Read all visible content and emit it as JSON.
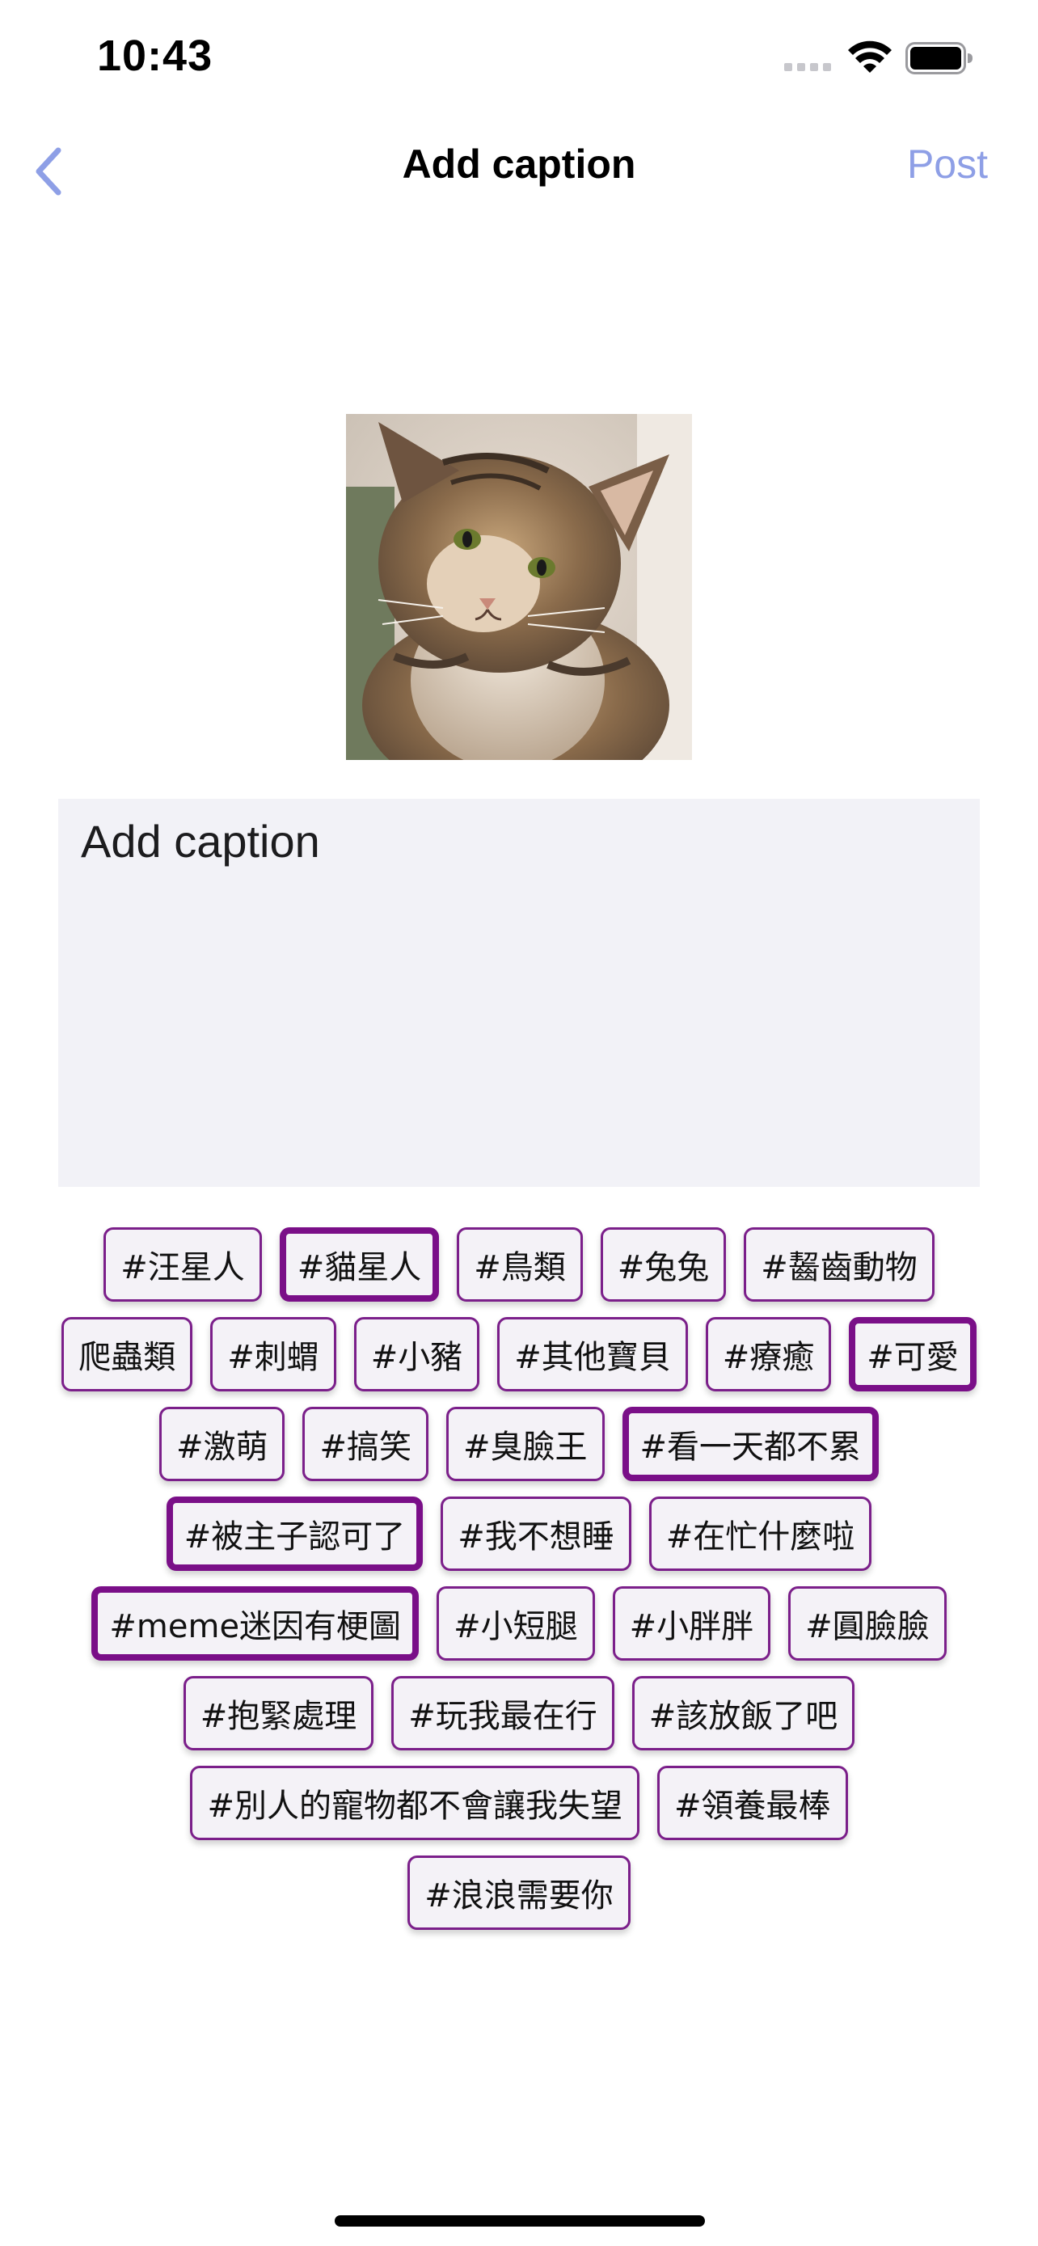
{
  "status_bar": {
    "time": "10:43",
    "wifi_icon": "wifi-icon",
    "battery_icon": "battery-icon"
  },
  "nav": {
    "back_icon": "chevron-left-icon",
    "title": "Add caption",
    "post_label": "Post",
    "accent_color": "#8e9fe6"
  },
  "photo": {
    "subject": "tabby-cat-photo"
  },
  "caption": {
    "placeholder": "Add caption",
    "value": ""
  },
  "tags": {
    "rows": [
      [
        {
          "label": "#汪星人",
          "selected": false
        },
        {
          "label": "#貓星人",
          "selected": true
        },
        {
          "label": "#鳥類",
          "selected": false
        },
        {
          "label": "#兔兔",
          "selected": false
        },
        {
          "label": "#齧齒動物",
          "selected": false
        }
      ],
      [
        {
          "label": "爬蟲類",
          "selected": false
        },
        {
          "label": "#刺蝟",
          "selected": false
        },
        {
          "label": "#小豬",
          "selected": false
        },
        {
          "label": "#其他寶貝",
          "selected": false
        },
        {
          "label": "#療癒",
          "selected": false
        },
        {
          "label": "#可愛",
          "selected": true
        }
      ],
      [
        {
          "label": "#激萌",
          "selected": false
        },
        {
          "label": "#搞笑",
          "selected": false
        },
        {
          "label": "#臭臉王",
          "selected": false
        },
        {
          "label": "#看一天都不累",
          "selected": true
        }
      ],
      [
        {
          "label": "#被主子認可了",
          "selected": true
        },
        {
          "label": "#我不想睡",
          "selected": false
        },
        {
          "label": "#在忙什麼啦",
          "selected": false
        }
      ],
      [
        {
          "label": "#meme迷因有梗圖",
          "selected": true
        },
        {
          "label": "#小短腿",
          "selected": false
        },
        {
          "label": "#小胖胖",
          "selected": false
        },
        {
          "label": "#圓臉臉",
          "selected": false
        }
      ],
      [
        {
          "label": "#抱緊處理",
          "selected": false
        },
        {
          "label": "#玩我最在行",
          "selected": false
        },
        {
          "label": "#該放飯了吧",
          "selected": false
        }
      ],
      [
        {
          "label": "#別人的寵物都不會讓我失望",
          "selected": false
        },
        {
          "label": "#領養最棒",
          "selected": false
        }
      ],
      [
        {
          "label": "#浪浪需要你",
          "selected": false
        }
      ]
    ],
    "border_color": "#7a0f88"
  }
}
